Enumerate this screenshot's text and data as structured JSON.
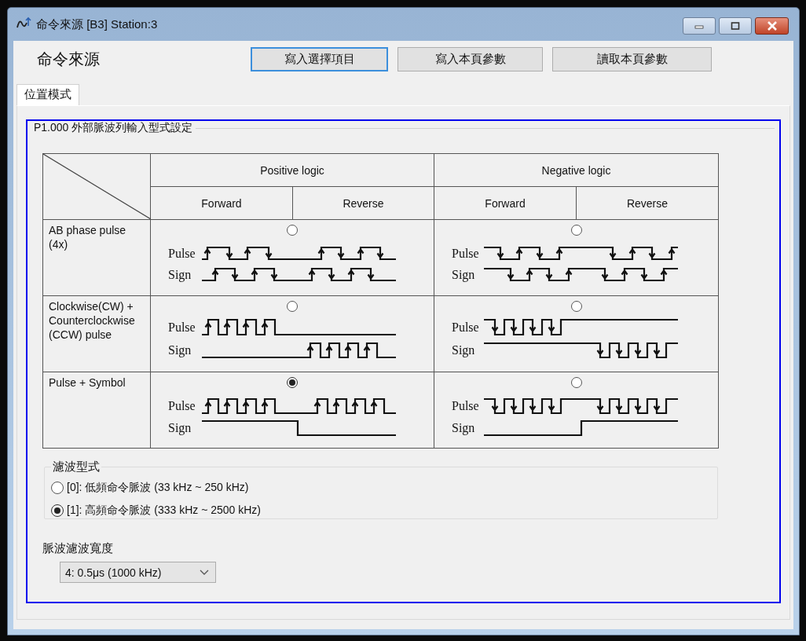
{
  "window": {
    "title": "命令來源 [B3] Station:3"
  },
  "header": {
    "title": "命令來源",
    "buttons": [
      {
        "label": "寫入選擇項目",
        "focused": true
      },
      {
        "label": "寫入本頁參數",
        "focused": false
      },
      {
        "label": "讀取本頁參數",
        "focused": false
      }
    ]
  },
  "tabs": [
    {
      "label": "位置模式",
      "selected": true
    }
  ],
  "group": {
    "title": "P1.000 外部脈波列輸入型式設定",
    "table": {
      "columns": [
        {
          "label": "Positive logic",
          "subcolumns": [
            "Forward",
            "Reverse"
          ]
        },
        {
          "label": "Negative logic",
          "subcolumns": [
            "Forward",
            "Reverse"
          ]
        }
      ],
      "rows": [
        {
          "label": "AB phase pulse\n(4x)",
          "options": [
            {
              "selected": false,
              "pulse_label": "Pulse",
              "sign_label": "Sign"
            },
            {
              "selected": false,
              "pulse_label": "Pulse",
              "sign_label": "Sign"
            }
          ]
        },
        {
          "label": "Clockwise(CW) +\nCounterclockwise\n(CCW) pulse",
          "options": [
            {
              "selected": false,
              "pulse_label": "Pulse",
              "sign_label": "Sign"
            },
            {
              "selected": false,
              "pulse_label": "Pulse",
              "sign_label": "Sign"
            }
          ]
        },
        {
          "label": "Pulse + Symbol",
          "options": [
            {
              "selected": true,
              "pulse_label": "Pulse",
              "sign_label": "Sign"
            },
            {
              "selected": false,
              "pulse_label": "Pulse",
              "sign_label": "Sign"
            }
          ]
        }
      ]
    },
    "filter": {
      "title": "濾波型式",
      "options": [
        {
          "label": "[0]: 低頻命令脈波 (33 kHz ~ 250 kHz)",
          "selected": false
        },
        {
          "label": "[1]: 高頻命令脈波 (333 kHz ~ 2500 kHz)",
          "selected": true
        }
      ]
    },
    "width": {
      "label": "脈波濾波寬度",
      "value": "4: 0.5μs (1000 kHz)"
    }
  }
}
